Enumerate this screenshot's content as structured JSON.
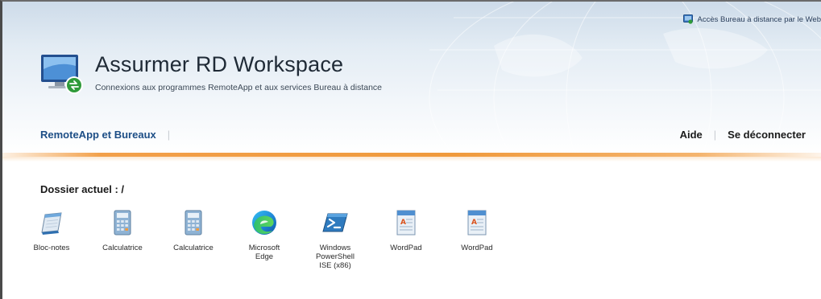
{
  "header": {
    "top_link": "Accès Bureau à distance par le Web",
    "title": "Assurmer RD Workspace",
    "subtitle": "Connexions aux programmes RemoteApp et aux services Bureau à distance"
  },
  "nav": {
    "left_item": "RemoteApp et Bureaux",
    "right_items": [
      "Aide",
      "Se déconnecter"
    ]
  },
  "folder": {
    "label": "Dossier actuel : /"
  },
  "apps": [
    {
      "label": "Bloc-notes",
      "icon": "notepad-icon"
    },
    {
      "label": "Calculatrice",
      "icon": "calculator-icon"
    },
    {
      "label": "Calculatrice",
      "icon": "calculator-icon"
    },
    {
      "label": "Microsoft\nEdge",
      "icon": "edge-icon"
    },
    {
      "label": "Windows\nPowerShell\nISE (x86)",
      "icon": "powershell-icon"
    },
    {
      "label": "WordPad",
      "icon": "wordpad-icon"
    },
    {
      "label": "WordPad",
      "icon": "wordpad-icon"
    }
  ],
  "colors": {
    "nav_link": "#1d4e86",
    "accent_orange": "#f09a3c",
    "header_top": "#cddbe9"
  }
}
